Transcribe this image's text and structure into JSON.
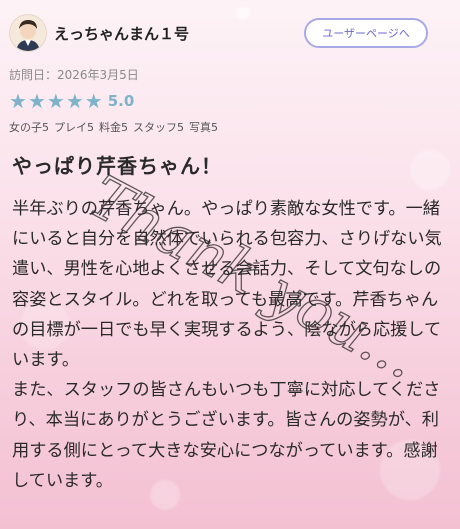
{
  "header": {
    "username": "えっちゃんまん１号",
    "user_button": "ユーザーページへ"
  },
  "visit": "訪問日：2026年3月5日",
  "rating": {
    "stars": 5,
    "max": 5,
    "score": "5.0",
    "star_color": "#7fb3c9"
  },
  "categories": [
    "女の子5",
    "プレイ5",
    "料金5",
    "スタッフ5",
    "写真5"
  ],
  "review": {
    "title": "やっぱり芹香ちゃん！",
    "paragraphs": [
      "半年ぶりの芹香ちゃん。やっぱり素敵な女性です。一緒にいると自分を自然体でいられる包容力、さりげない気遣い、男性を心地よくさせる会話力、そして文句なしの容姿とスタイル。どれを取っても最高です。芹香ちゃんの目標が一日でも早く実現するよう、陰ながら応援しています。",
      "また、スタッフの皆さんもいつも丁寧に対応してくださり、本当にありがとうございます。皆さんの姿勢が、利用する側にとって大きな安心につながっています。感謝しています。"
    ]
  },
  "watermark": "Thank you...",
  "colors": {
    "accent_button": "#a9a9e6",
    "background": "#f7cfdd"
  }
}
